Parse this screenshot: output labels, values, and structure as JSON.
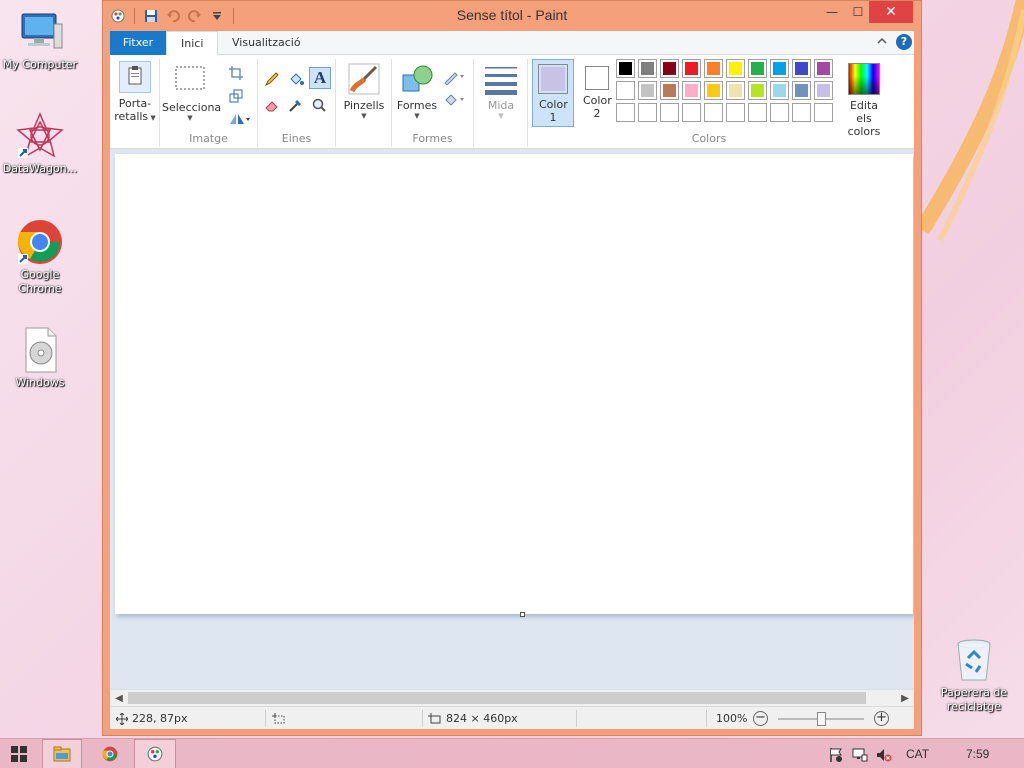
{
  "desktop": {
    "icons": [
      {
        "label": "My Computer"
      },
      {
        "label": "DataWagon..."
      },
      {
        "label": "Google Chrome"
      },
      {
        "label": "Windows"
      },
      {
        "label": "Paperera de reciclatge"
      }
    ]
  },
  "window": {
    "title": "Sense títol - Paint",
    "controls": {
      "minimize": "—",
      "maximize": "☐",
      "close": "✕"
    }
  },
  "tabs": {
    "file": "Fitxer",
    "home": "Inici",
    "view": "Visualització",
    "help": "?"
  },
  "ribbon": {
    "clipboard": {
      "label": "Porta-retalls"
    },
    "image": {
      "select": "Selecciona",
      "group": "Imatge"
    },
    "tools": {
      "group": "Eines",
      "text_glyph": "A"
    },
    "brushes": {
      "label": "Pinzells"
    },
    "shapes": {
      "label": "Formes",
      "group": "Formes"
    },
    "size": {
      "label": "Mida"
    },
    "colors": {
      "color1": "Color 1",
      "color2": "Color 2",
      "edit": "Edita els colors",
      "group": "Colors",
      "color1_value": "#c8c3e6",
      "color2_value": "#ffffff",
      "palette": [
        "#000000",
        "#7f7f7f",
        "#880015",
        "#ed1c24",
        "#ff7f27",
        "#fff200",
        "#22b14c",
        "#00a2e8",
        "#3f48cc",
        "#a349a4",
        "#ffffff",
        "#c3c3c3",
        "#b97a57",
        "#ffaec9",
        "#ffc90e",
        "#efe4b0",
        "#b5e61d",
        "#99d9ea",
        "#7092be",
        "#c8bfe7",
        "#ffffff",
        "#ffffff",
        "#ffffff",
        "#ffffff",
        "#ffffff",
        "#ffffff",
        "#ffffff",
        "#ffffff",
        "#ffffff",
        "#ffffff"
      ]
    }
  },
  "status": {
    "cursor": "228, 87px",
    "size": "824 × 460px",
    "zoom": "100%"
  },
  "taskbar": {
    "lang": "CAT",
    "time": "7:59"
  }
}
